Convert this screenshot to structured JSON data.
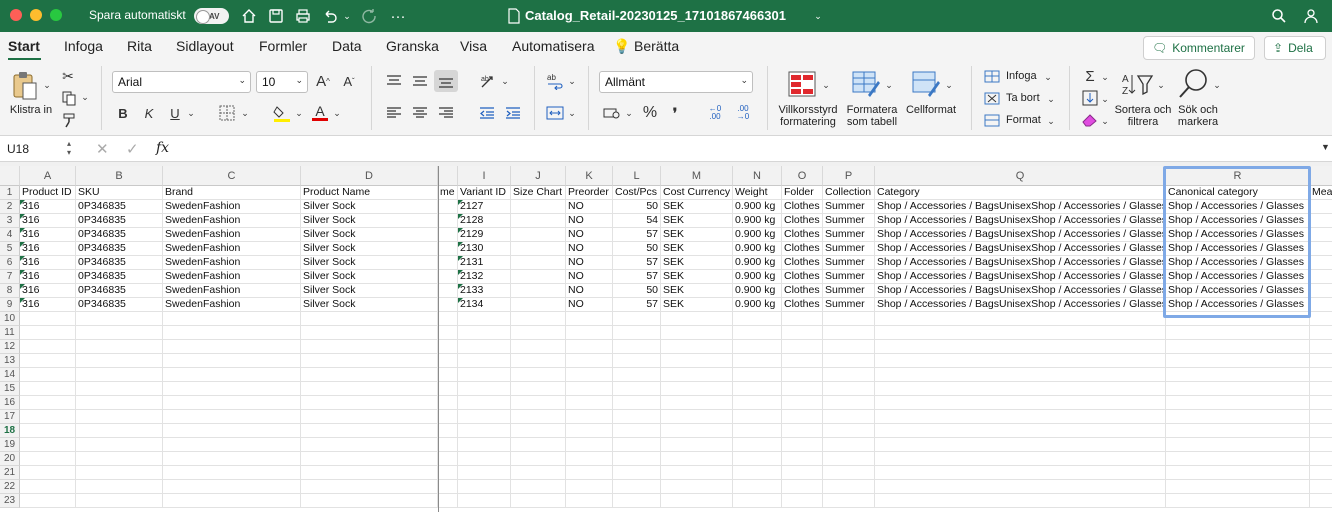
{
  "titlebar": {
    "autosave_label": "Spara automatiskt",
    "toggle_state": "AV",
    "filename": "Catalog_Retail-20230125_17101867466301"
  },
  "tabs": [
    "Start",
    "Infoga",
    "Rita",
    "Sidlayout",
    "Formler",
    "Data",
    "Granska",
    "Visa",
    "Automatisera",
    "Berätta"
  ],
  "top_buttons": {
    "comment": "Kommentarer",
    "share": "Dela"
  },
  "ribbon": {
    "paste_label": "Klistra in",
    "font_name": "Arial",
    "font_size": "10",
    "number_format": "Allmänt",
    "bold": "B",
    "italic": "K",
    "underline": "U",
    "percent": "%",
    "comma": "❜",
    "dec_inc": "←0 .00",
    "dec_dec": ".00 →0",
    "cond_format": "Villkorsstyrd formatering",
    "format_table": "Formatera som tabell",
    "cell_format": "Cellformat",
    "insert": "Infoga",
    "delete": "Ta bort",
    "format": "Format",
    "sort_filter": "Sortera och filtrera",
    "find_select": "Sök och markera",
    "font_up": "A",
    "font_down": "A"
  },
  "formula_bar": {
    "name_box": "U18",
    "fx": "fx",
    "content": ""
  },
  "sheet": {
    "columns": [
      {
        "letter": "A",
        "header": "Product ID"
      },
      {
        "letter": "B",
        "header": "SKU"
      },
      {
        "letter": "C",
        "header": "Brand"
      },
      {
        "letter": "D",
        "header": "Product Name"
      },
      {
        "letter": "",
        "header": "me"
      },
      {
        "letter": "I",
        "header": "Variant ID"
      },
      {
        "letter": "J",
        "header": "Size Chart"
      },
      {
        "letter": "K",
        "header": "Preorder"
      },
      {
        "letter": "L",
        "header": "Cost/Pcs"
      },
      {
        "letter": "M",
        "header": "Cost Currency"
      },
      {
        "letter": "N",
        "header": "Weight"
      },
      {
        "letter": "O",
        "header": "Folder"
      },
      {
        "letter": "P",
        "header": "Collection"
      },
      {
        "letter": "Q",
        "header": "Category"
      },
      {
        "letter": "R",
        "header": "Canonical category"
      },
      {
        "letter": "",
        "header": "Mea"
      }
    ],
    "rows": [
      [
        "316",
        "0P346835",
        "SwedenFashion",
        "Silver Sock",
        "",
        "2127",
        "",
        "NO",
        "50",
        "SEK",
        "0.900 kg",
        "Clothes",
        "Summer",
        "Shop / Accessories / BagsUnisexShop / Accessories / Glasses",
        "Shop / Accessories / Glasses",
        ""
      ],
      [
        "316",
        "0P346835",
        "SwedenFashion",
        "Silver Sock",
        "",
        "2128",
        "",
        "NO",
        "54",
        "SEK",
        "0.900 kg",
        "Clothes",
        "Summer",
        "Shop / Accessories / BagsUnisexShop / Accessories / Glasses",
        "Shop / Accessories / Glasses",
        ""
      ],
      [
        "316",
        "0P346835",
        "SwedenFashion",
        "Silver Sock",
        "",
        "2129",
        "",
        "NO",
        "57",
        "SEK",
        "0.900 kg",
        "Clothes",
        "Summer",
        "Shop / Accessories / BagsUnisexShop / Accessories / Glasses",
        "Shop / Accessories / Glasses",
        ""
      ],
      [
        "316",
        "0P346835",
        "SwedenFashion",
        "Silver Sock",
        "",
        "2130",
        "",
        "NO",
        "50",
        "SEK",
        "0.900 kg",
        "Clothes",
        "Summer",
        "Shop / Accessories / BagsUnisexShop / Accessories / Glasses",
        "Shop / Accessories / Glasses",
        ""
      ],
      [
        "316",
        "0P346835",
        "SwedenFashion",
        "Silver Sock",
        "",
        "2131",
        "",
        "NO",
        "57",
        "SEK",
        "0.900 kg",
        "Clothes",
        "Summer",
        "Shop / Accessories / BagsUnisexShop / Accessories / Glasses",
        "Shop / Accessories / Glasses",
        ""
      ],
      [
        "316",
        "0P346835",
        "SwedenFashion",
        "Silver Sock",
        "",
        "2132",
        "",
        "NO",
        "57",
        "SEK",
        "0.900 kg",
        "Clothes",
        "Summer",
        "Shop / Accessories / BagsUnisexShop / Accessories / Glasses",
        "Shop / Accessories / Glasses",
        ""
      ],
      [
        "316",
        "0P346835",
        "SwedenFashion",
        "Silver Sock",
        "",
        "2133",
        "",
        "NO",
        "50",
        "SEK",
        "0.900 kg",
        "Clothes",
        "Summer",
        "Shop / Accessories / BagsUnisexShop / Accessories / Glasses",
        "Shop / Accessories / Glasses",
        ""
      ],
      [
        "316",
        "0P346835",
        "SwedenFashion",
        "Silver Sock",
        "",
        "2134",
        "",
        "NO",
        "57",
        "SEK",
        "0.900 kg",
        "Clothes",
        "Summer",
        "Shop / Accessories / BagsUnisexShop / Accessories / Glasses",
        "Shop / Accessories / Glasses",
        ""
      ]
    ],
    "row_numbers": [
      "1",
      "2",
      "3",
      "4",
      "5",
      "6",
      "7",
      "8",
      "9",
      "10",
      "11",
      "12",
      "13",
      "14",
      "15",
      "16",
      "17",
      "18",
      "19",
      "20",
      "21",
      "22",
      "23"
    ],
    "selected_row": "18"
  },
  "colors": {
    "accent": "#1e7145",
    "selection": "#7fa9e6"
  }
}
